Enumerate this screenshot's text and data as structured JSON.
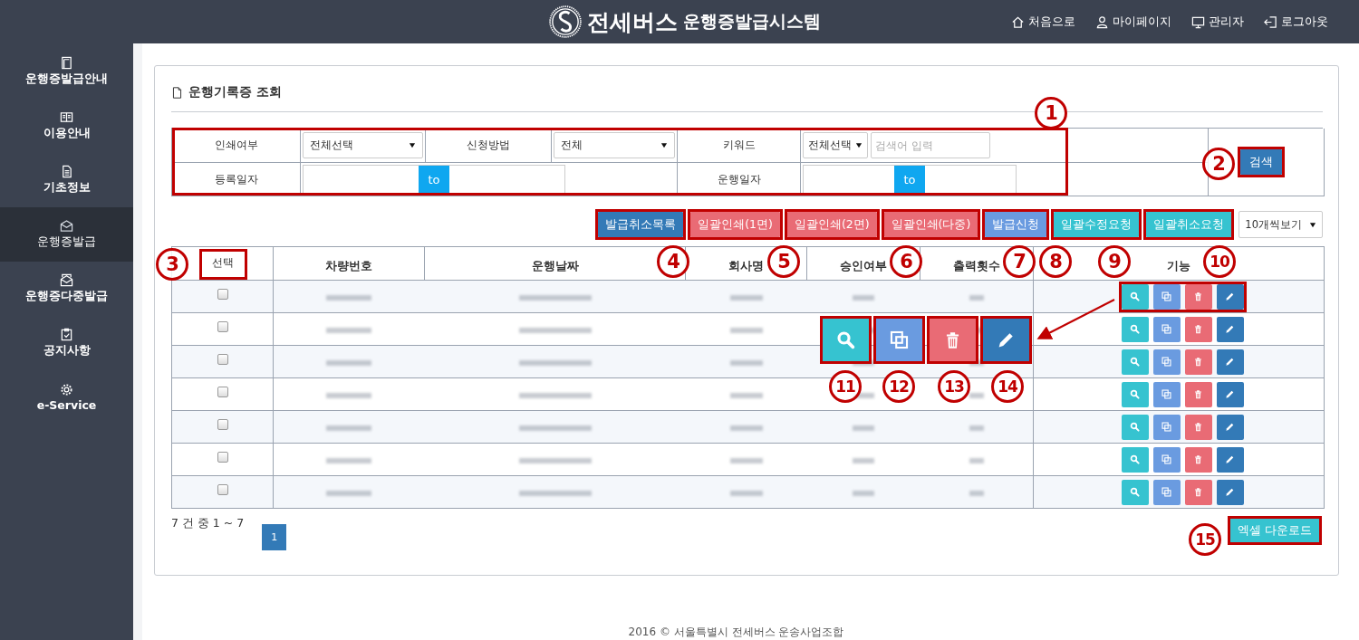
{
  "header": {
    "logo": "전세버스",
    "title": "운행증발급시스템",
    "nav": [
      {
        "kind": "home",
        "label": "처음으로"
      },
      {
        "kind": "user",
        "label": "마이페이지"
      },
      {
        "kind": "monitor",
        "label": "관리자"
      },
      {
        "kind": "logout",
        "label": "로그아웃"
      }
    ]
  },
  "sidebar": {
    "items": [
      {
        "kind": "document",
        "label": "운행증발급안내",
        "selected": false
      },
      {
        "kind": "book",
        "label": "이용안내",
        "selected": false
      },
      {
        "kind": "file",
        "label": "기초정보",
        "selected": false
      },
      {
        "kind": "mail",
        "label": "운행증발급",
        "selected": true
      },
      {
        "kind": "mail-stack",
        "label": "운행증다중발급",
        "selected": false
      },
      {
        "kind": "clipboard",
        "label": "공지사항",
        "selected": false
      },
      {
        "kind": "gear",
        "label": "e-Service",
        "selected": false
      }
    ]
  },
  "page_title": "운행기록증 조회",
  "search": {
    "print_label": "인쇄여부",
    "print_value": "전체선택",
    "method_label": "신청방법",
    "method_value": "전체",
    "keyword_label": "키워드",
    "keyword_scope": "전체선택",
    "keyword_placeholder": "검색어 입력",
    "reg_date_label": "등록일자",
    "reg_date_separator": "to",
    "run_date_label": "운행일자",
    "run_date_separator": "to",
    "search_button": "검색"
  },
  "toolbar": {
    "buttons": [
      {
        "label": "발급취소목록",
        "color": "#337ab7"
      },
      {
        "label": "일괄인쇄(1면)",
        "color": "#e96b75"
      },
      {
        "label": "일괄인쇄(2면)",
        "color": "#e96b75"
      },
      {
        "label": "일괄인쇄(다중)",
        "color": "#e96b75"
      },
      {
        "label": "발급신청",
        "color": "#6a9be0"
      },
      {
        "label": "일괄수정요청",
        "color": "#36c3d0"
      },
      {
        "label": "일괄취소요청",
        "color": "#36c3d0"
      }
    ],
    "page_size": "10개씩보기"
  },
  "table": {
    "columns": [
      "선택",
      "차량번호",
      "운행날짜",
      "회사명",
      "승인여부",
      "출력횟수",
      "기능"
    ],
    "actions": [
      {
        "kind": "view",
        "color": "#36c3d0"
      },
      {
        "kind": "copy",
        "color": "#6a9be0"
      },
      {
        "kind": "delete",
        "color": "#e96b75"
      },
      {
        "kind": "edit",
        "color": "#337ab7"
      }
    ],
    "rows": [
      {
        "checked": false
      },
      {
        "checked": false
      },
      {
        "checked": false
      },
      {
        "checked": false
      },
      {
        "checked": false
      },
      {
        "checked": false
      },
      {
        "checked": false
      }
    ]
  },
  "summary": "7 건 중 1 ~ 7",
  "pages": [
    {
      "label": "1",
      "selected": true
    }
  ],
  "excel_button": "엑셀 다운로드",
  "footer": "2016 © 서울특별시 전세버스 운송사업조합",
  "callouts": [
    "1",
    "2",
    "3",
    "4",
    "5",
    "6",
    "7",
    "8",
    "9",
    "10",
    "11",
    "12",
    "13",
    "14",
    "15"
  ]
}
